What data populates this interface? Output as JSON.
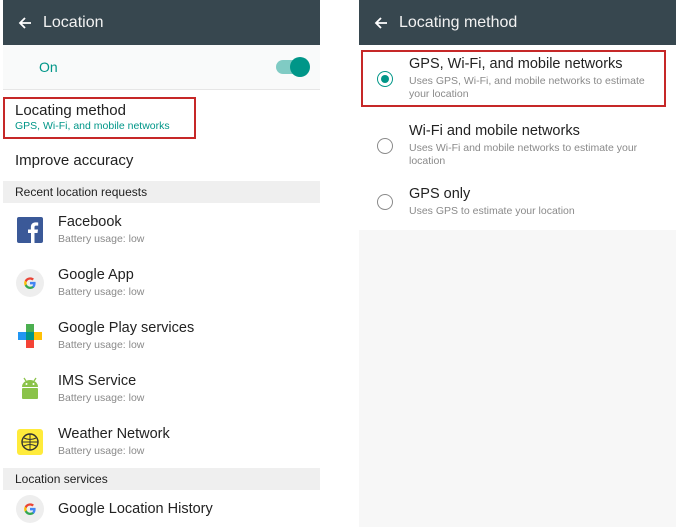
{
  "left": {
    "title": "Location",
    "toggle_label": "On",
    "locating": {
      "title": "Locating method",
      "value": "GPS, Wi-Fi, and mobile networks"
    },
    "improve": "Improve accuracy",
    "recent_header": "Recent location requests",
    "apps": [
      {
        "name": "Facebook",
        "usage": "Battery usage: low"
      },
      {
        "name": "Google App",
        "usage": "Battery usage: low"
      },
      {
        "name": "Google Play services",
        "usage": "Battery usage: low"
      },
      {
        "name": "IMS Service",
        "usage": "Battery usage: low"
      },
      {
        "name": "Weather Network",
        "usage": "Battery usage: low"
      }
    ],
    "services_header": "Location services",
    "service_item": "Google Location History"
  },
  "right": {
    "title": "Locating method",
    "options": [
      {
        "title": "GPS, Wi-Fi, and mobile networks",
        "desc": "Uses GPS, Wi-Fi, and mobile networks to estimate your location",
        "selected": true
      },
      {
        "title": "Wi-Fi and mobile networks",
        "desc": "Uses Wi-Fi and mobile networks to estimate your location",
        "selected": false
      },
      {
        "title": "GPS only",
        "desc": "Uses GPS to estimate your location",
        "selected": false
      }
    ]
  },
  "colors": {
    "topbar": "#37474f",
    "accent": "#009688",
    "highlight": "#c62828"
  }
}
